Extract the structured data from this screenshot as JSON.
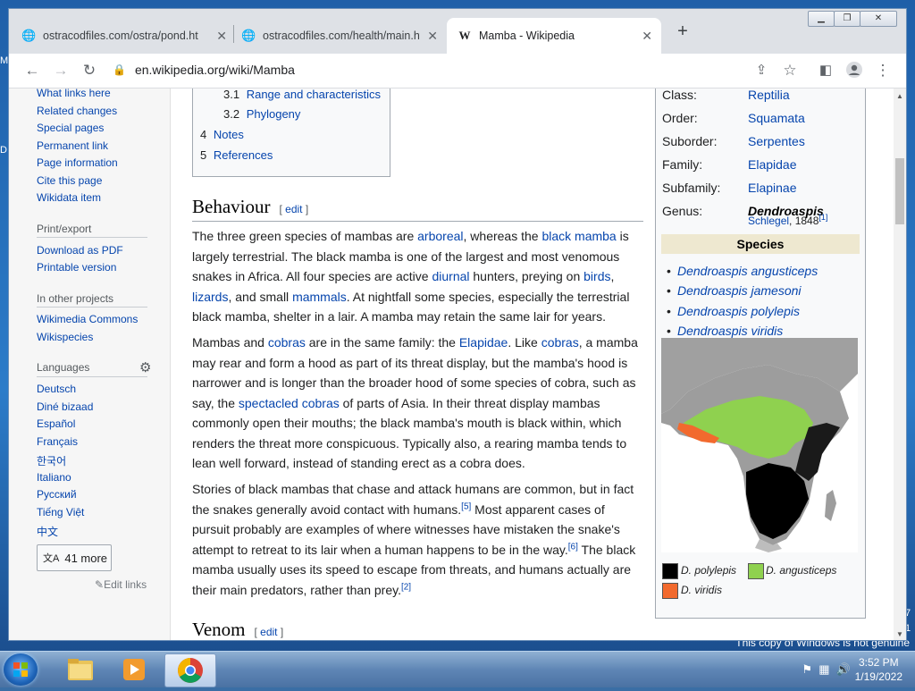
{
  "tabs": [
    {
      "title": "ostracodfiles.com/ostra/pond.htm",
      "icon": "globe-icon"
    },
    {
      "title": "ostracodfiles.com/health/main.htm",
      "icon": "globe-icon"
    },
    {
      "title": "Mamba - Wikipedia",
      "icon": "wikipedia-icon"
    }
  ],
  "address": "en.wikipedia.org/wiki/Mamba",
  "sidebar": {
    "tools": [
      "What links here",
      "Related changes",
      "Special pages",
      "Permanent link",
      "Page information",
      "Cite this page",
      "Wikidata item"
    ],
    "print_head": "Print/export",
    "print_links": [
      "Download as PDF",
      "Printable version"
    ],
    "projects_head": "In other projects",
    "project_links": [
      "Wikimedia Commons",
      "Wikispecies"
    ],
    "languages_head": "Languages",
    "languages": [
      "Deutsch",
      "Diné bizaad",
      "Español",
      "Français",
      "한국어",
      "Italiano",
      "Русский",
      "Tiếng Việt",
      "中文"
    ],
    "more_label": "41 more",
    "edit_links": "Edit links"
  },
  "toc": [
    {
      "num": "3.1",
      "label": "Range and characteristics"
    },
    {
      "num": "3.2",
      "label": "Phylogeny"
    },
    {
      "num": "4",
      "label": "Notes"
    },
    {
      "num": "5",
      "label": "References"
    }
  ],
  "behaviour": {
    "heading": "Behaviour",
    "edit": "edit",
    "p1": {
      "a": "The three green species of mambas are ",
      "l1": "arboreal",
      "b": ", whereas the ",
      "l2": "black mamba",
      "c": " is largely terrestrial. The black mamba is one of the largest and most venomous snakes in Africa. All four species are active ",
      "l3": "diurnal",
      "d": " hunters, preying on ",
      "l4": "birds",
      "e": ", ",
      "l5": "lizards",
      "f": ", and small ",
      "l6": "mammals",
      "g": ". At nightfall some species, especially the terrestrial black mamba, shelter in a lair. A mamba may retain the same lair for years."
    },
    "p2": {
      "a": "Mambas and ",
      "l1": "cobras",
      "b": " are in the same family: the ",
      "l2": "Elapidae",
      "c": ". Like ",
      "l3": "cobras",
      "d": ", a mamba may rear and form a hood as part of its threat display, but the mamba's hood is narrower and is longer than the broader hood of some species of cobra, such as say, the ",
      "l4": "spectacled cobras",
      "e": " of parts of Asia. In their threat display mambas commonly open their mouths; the black mamba's mouth is black within, which renders the threat more conspicuous. Typically also, a rearing mamba tends to lean well forward, instead of standing erect as a cobra does."
    },
    "p3": {
      "a": "Stories of black mambas that chase and attack humans are common, but in fact the snakes generally avoid contact with humans.",
      "r1": "[5]",
      "b": " Most apparent cases of pursuit probably are examples of where witnesses have mistaken the snake's attempt to retreat to its lair when a human happens to be in the way.",
      "r2": "[6]",
      "c": " The black mamba usually uses its speed to escape from threats, and humans actually are their main predators, rather than prey.",
      "r3": "[2]"
    }
  },
  "venom": {
    "heading": "Venom",
    "edit": "edit"
  },
  "infobox": {
    "rows": [
      {
        "label": "Class:",
        "value": "Reptilia"
      },
      {
        "label": "Order:",
        "value": "Squamata"
      },
      {
        "label": "Suborder:",
        "value": "Serpentes"
      },
      {
        "label": "Family:",
        "value": "Elapidae"
      },
      {
        "label": "Subfamily:",
        "value": "Elapinae"
      }
    ],
    "genus_label": "Genus:",
    "genus_value": "Dendroaspis",
    "authority_name": "Schlegel",
    "authority_year": ", 1848",
    "authority_ref": "[1]",
    "species_head": "Species",
    "species": [
      "Dendroaspis angusticeps",
      "Dendroaspis jamesoni",
      "Dendroaspis polylepis",
      "Dendroaspis viridis"
    ],
    "legend": [
      {
        "label": "D. polylepis",
        "color": "#000000"
      },
      {
        "label": "D. angusticeps",
        "color": "#8fd14f"
      },
      {
        "label": "D. viridis",
        "color": "#f26a2e"
      }
    ]
  },
  "taskbar": {
    "time": "3:52 PM",
    "date": "1/19/2022"
  },
  "desktop": {
    "genuine_notice": "This copy of Windows is not genuine"
  }
}
